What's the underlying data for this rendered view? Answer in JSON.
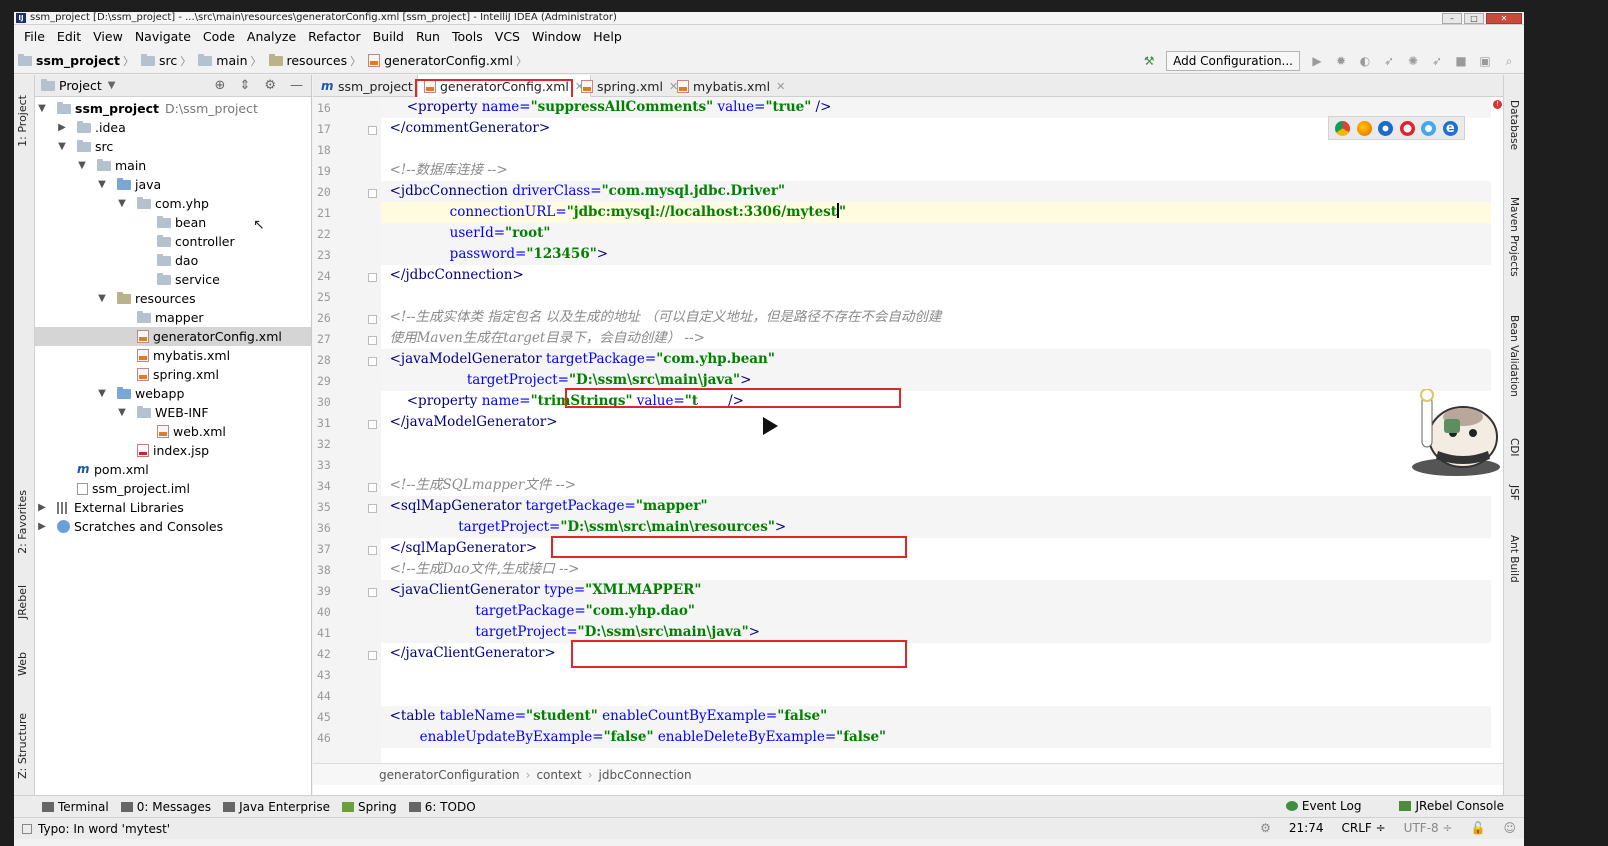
{
  "window": {
    "title": "ssm_project [D:\\ssm_project] - ...\\src\\main\\resources\\generatorConfig.xml [ssm_project] - IntelliJ IDEA (Administrator)",
    "app_icon": "IJ"
  },
  "menu": [
    "File",
    "Edit",
    "View",
    "Navigate",
    "Code",
    "Analyze",
    "Refactor",
    "Build",
    "Run",
    "Tools",
    "VCS",
    "Window",
    "Help"
  ],
  "navbar": {
    "crumbs": [
      "ssm_project",
      "src",
      "main",
      "resources",
      "generatorConfig.xml"
    ],
    "add_configuration": "Add Configuration..."
  },
  "left_tabs": [
    "1: Project",
    "2: Favorites",
    "JRebel",
    "Web",
    "Z: Structure"
  ],
  "right_tabs": [
    "Database",
    "Maven Projects",
    "Bean Validation",
    "CDI",
    "JSF",
    "Ant Build"
  ],
  "project_panel": {
    "title": "Project",
    "tree": [
      {
        "label": "ssm_project",
        "path": "D:\\ssm_project"
      },
      {
        "label": ".idea"
      },
      {
        "label": "src"
      },
      {
        "label": "main"
      },
      {
        "label": "java"
      },
      {
        "label": "com.yhp"
      },
      {
        "label": "bean"
      },
      {
        "label": "controller"
      },
      {
        "label": "dao"
      },
      {
        "label": "service"
      },
      {
        "label": "resources"
      },
      {
        "label": "mapper"
      },
      {
        "label": "generatorConfig.xml"
      },
      {
        "label": "mybatis.xml"
      },
      {
        "label": "spring.xml"
      },
      {
        "label": "webapp"
      },
      {
        "label": "WEB-INF"
      },
      {
        "label": "web.xml"
      },
      {
        "label": "index.jsp"
      },
      {
        "label": "pom.xml"
      },
      {
        "label": "ssm_project.iml"
      },
      {
        "label": "External Libraries"
      },
      {
        "label": "Scratches and Consoles"
      }
    ]
  },
  "tabs": [
    "ssm_project",
    "generatorConfig.xml",
    "spring.xml",
    "mybatis.xml"
  ],
  "editor": {
    "lines": [
      16,
      17,
      18,
      19,
      20,
      21,
      22,
      23,
      24,
      25,
      26,
      27,
      28,
      29,
      30,
      31,
      32,
      33,
      34,
      35,
      36,
      37,
      38,
      39,
      40,
      41,
      42,
      43,
      44,
      45,
      46
    ],
    "code": {
      "l16_attr1": "name=",
      "l16_val1": "\"suppressAllComments\"",
      "l16_attr2": "value=",
      "l16_val2": "\"true\"",
      "l19_comment": "<!--数据库连接 -->",
      "l20_tag": "jdbcConnection",
      "l20_attr": "driverClass=",
      "l20_val": "\"com.mysql.jdbc.Driver\"",
      "l21_attr": "connectionURL=",
      "l21_val": "\"jdbc:mysql://localhost:3306/mytest",
      "l22_attr": "userId=",
      "l22_val": "\"root\"",
      "l23_attr": "password=",
      "l23_val": "\"123456\"",
      "l26_comment": "<!--生成实体类 指定包名 以及生成的地址 （可以自定义地址，但是路径不存在不会自动创建",
      "l27_comment": "使用Maven生成在target目录下，会自动创建） -->",
      "l28_tag": "javaModelGenerator",
      "l28_attr": "targetPackage=",
      "l28_val": "\"com.yhp.bean\"",
      "l29_attr": "targetProject=",
      "l29_val": "\"D:\\ssm\\src\\main\\java\"",
      "l30_attr1": "name=",
      "l30_val1": "\"trimStrings\"",
      "l30_attr2": "value=",
      "l30_val2": "\"t",
      "l34_comment": "<!--生成SQLmapper文件 -->",
      "l35_tag": "sqlMapGenerator",
      "l35_attr": "targetPackage=",
      "l35_val": "\"mapper\"",
      "l36_attr": "targetProject=",
      "l36_val": "\"D:\\ssm\\src\\main\\resources\"",
      "l38_comment": "<!--生成Dao文件,生成接口 -->",
      "l39_tag": "javaClientGenerator",
      "l39_attr": "type=",
      "l39_val": "\"XMLMAPPER\"",
      "l40_attr": "targetPackage=",
      "l40_val": "\"com.yhp.dao\"",
      "l41_attr": "targetProject=",
      "l41_val": "\"D:\\ssm\\src\\main\\java\"",
      "l45_tag": "table",
      "l45_attr1": "tableName=",
      "l45_val1": "\"student\"",
      "l45_attr2": "enableCountByExample=",
      "l45_val2": "\"false\"",
      "l46_attr1": "enableUpdateByExample=",
      "l46_val1": "\"false\"",
      "l46_attr2": "enableDeleteByExample=",
      "l46_val2": "\"false\""
    },
    "breadcrumb": [
      "generatorConfiguration",
      "context",
      "jdbcConnection"
    ]
  },
  "bottom_tools": {
    "left": [
      "Terminal",
      "0: Messages",
      "Java Enterprise",
      "Spring",
      "6: TODO"
    ],
    "right": [
      "Event Log",
      "JRebel Console"
    ]
  },
  "status": {
    "message": "Typo: In word 'mytest'",
    "position": "21:74",
    "line_sep": "CRLF ÷",
    "encoding": "UTF-8 ÷"
  },
  "colors": {
    "highlight_box": "#e0262a",
    "tag": "#000080",
    "attr": "#0000ff",
    "value": "#008000",
    "comment": "#8a8a8a"
  }
}
